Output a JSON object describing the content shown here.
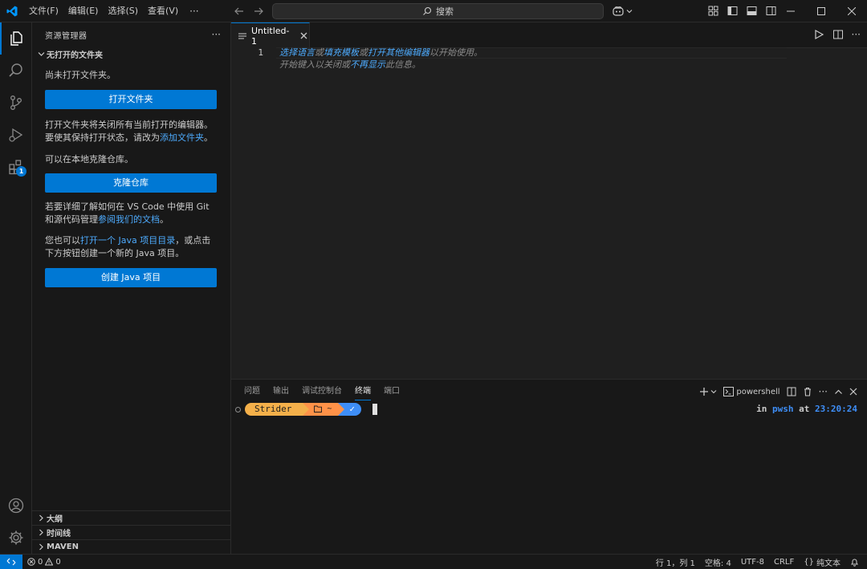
{
  "titlebar": {
    "menus": [
      "文件(F)",
      "编辑(E)",
      "选择(S)",
      "查看(V)"
    ],
    "more": "···",
    "search": "搜索"
  },
  "sidebar": {
    "title": "资源管理器",
    "more": "···",
    "section": "无打开的文件夹",
    "no_folder": "尚未打开文件夹。",
    "open_folder_btn": "打开文件夹",
    "info1_a": "打开文件夹将关闭所有当前打开的编辑器。要使其保持打开状态，请改为",
    "info1_link": "添加文件夹",
    "info1_b": "。",
    "clone_text": "可以在本地克隆仓库。",
    "clone_btn": "克隆仓库",
    "info2_a": "若要详细了解如何在 VS Code 中使用 Git 和源代码管理",
    "info2_link": "参阅我们的文档",
    "info2_b": "。",
    "info3_a": "您也可以",
    "info3_link": "打开一个 Java 项目目录",
    "info3_b": "，或点击下方按钮创建一个新的 Java 项目。",
    "java_btn": "创建 Java 项目",
    "collapsed": [
      "大纲",
      "时间线",
      "MAVEN"
    ]
  },
  "activity": {
    "badge": "1"
  },
  "editor": {
    "tab_label": "Untitled-1",
    "line_number": "1",
    "hint1_link1": "选择语言",
    "hint1_mid1": "或",
    "hint1_link2": "填充模板",
    "hint1_mid2": "或",
    "hint1_link3": "打开其他编辑器",
    "hint1_end": "以开始使用。",
    "hint2_a": "开始键入以关闭或",
    "hint2_link": "不再显示",
    "hint2_b": "此信息。"
  },
  "panel": {
    "tabs": [
      "问题",
      "输出",
      "调试控制台",
      "终端",
      "端口"
    ],
    "active_tab": "终端",
    "terminal_name": "powershell",
    "prompt_user": "Strider",
    "prompt_dir": "~",
    "prompt_check": "✓",
    "rprompt_in": "in",
    "rprompt_shell": "pwsh",
    "rprompt_at": "at",
    "rprompt_time": "23:20:24"
  },
  "statusbar": {
    "errors": "0",
    "warnings": "0",
    "position": "行 1，列 1",
    "spaces": "空格: 4",
    "encoding": "UTF-8",
    "eol": "CRLF",
    "braces": "{}",
    "language": "纯文本"
  },
  "colors": {
    "accent": "#0078d4",
    "link": "#4daafc"
  }
}
